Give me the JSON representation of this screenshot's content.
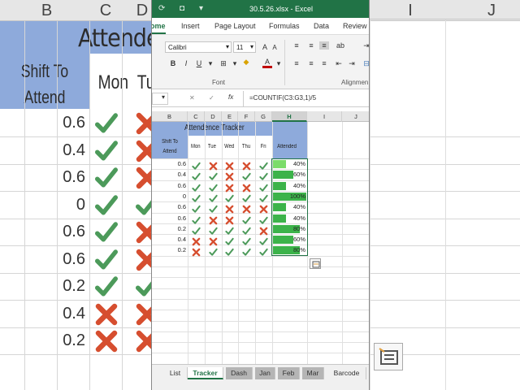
{
  "window": {
    "title": "30.5.26.xlsx  -  Excel"
  },
  "ribbon_tabs": [
    {
      "label": "ome",
      "active": true
    },
    {
      "label": "Insert",
      "active": false
    },
    {
      "label": "Page Layout",
      "active": false
    },
    {
      "label": "Formulas",
      "active": false
    },
    {
      "label": "Data",
      "active": false
    },
    {
      "label": "Review",
      "active": false
    }
  ],
  "ribbon": {
    "font_name": "Calibri",
    "font_size": "11",
    "bold": "B",
    "italic": "I",
    "underline": "U",
    "font_color": "A",
    "font_group_label": "Font",
    "alignment_group_label": "Alignmen"
  },
  "formula_bar": {
    "formula": "=COUNTIF(C3:G3,1)/5",
    "fx": "fx"
  },
  "columns": [
    "B",
    "C",
    "D",
    "E",
    "F",
    "G",
    "H",
    "I",
    "J"
  ],
  "selected_column": "H",
  "tracker": {
    "title": "Attendence Tracker",
    "shift_header": "Shift To Attend",
    "day_headers": [
      "Mon",
      "Tue",
      "Wed",
      "Thu",
      "Fri"
    ],
    "attended_header": "Attended",
    "rows": [
      {
        "shift": "0.6",
        "days": [
          1,
          0,
          0,
          0,
          1
        ],
        "attended": "40%",
        "pct": 40
      },
      {
        "shift": "0.4",
        "days": [
          1,
          1,
          0,
          1,
          1
        ],
        "attended": "60%",
        "pct": 60
      },
      {
        "shift": "0.6",
        "days": [
          1,
          1,
          0,
          0,
          1
        ],
        "attended": "40%",
        "pct": 40
      },
      {
        "shift": "0",
        "days": [
          1,
          1,
          1,
          1,
          1
        ],
        "attended": "100%",
        "pct": 100
      },
      {
        "shift": "0.6",
        "days": [
          1,
          1,
          0,
          0,
          0
        ],
        "attended": "40%",
        "pct": 40
      },
      {
        "shift": "0.6",
        "days": [
          1,
          0,
          0,
          1,
          1
        ],
        "attended": "40%",
        "pct": 40
      },
      {
        "shift": "0.2",
        "days": [
          1,
          1,
          1,
          1,
          0
        ],
        "attended": "80%",
        "pct": 80
      },
      {
        "shift": "0.4",
        "days": [
          0,
          0,
          1,
          1,
          1
        ],
        "attended": "60%",
        "pct": 60
      },
      {
        "shift": "0.2",
        "days": [
          0,
          1,
          1,
          1,
          1
        ],
        "attended": "80%",
        "pct": 80
      }
    ]
  },
  "sheet_tabs": [
    {
      "label": "List",
      "state": "normal"
    },
    {
      "label": "Tracker",
      "state": "active"
    },
    {
      "label": "Dash",
      "state": "gray"
    },
    {
      "label": "Jan",
      "state": "gray"
    },
    {
      "label": "Feb",
      "state": "gray"
    },
    {
      "label": "Mar",
      "state": "gray"
    },
    {
      "label": "Barcode",
      "state": "normal"
    }
  ],
  "background": {
    "columns": [
      "B",
      "C",
      "D",
      "I",
      "J"
    ],
    "title": "Attenden",
    "shift_header": "Shift To Attend",
    "day_headers": [
      "Mon",
      "Tu"
    ],
    "shift_values": [
      "0.6",
      "0.4",
      "0.6",
      "0",
      "0.6",
      "0.6",
      "0.2",
      "0.4",
      "0.2"
    ],
    "mon_marks": [
      1,
      1,
      1,
      1,
      1,
      1,
      1,
      0,
      0
    ]
  },
  "colors": {
    "excel_green": "#217346",
    "header_blue": "#8eaadb",
    "check_green": "#4c9a5a",
    "cross_red": "#d64e2f",
    "bar_green": "#3cb34a"
  }
}
